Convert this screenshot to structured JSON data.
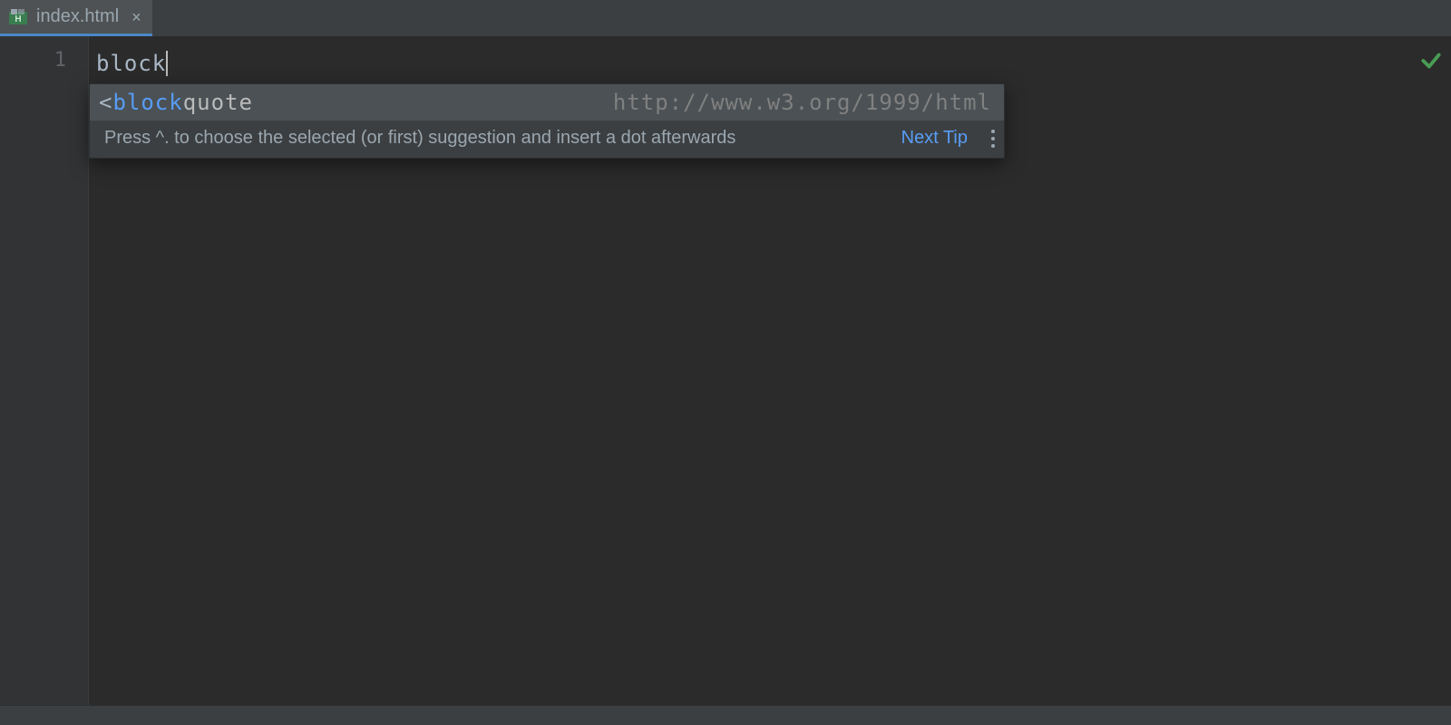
{
  "tab": {
    "label": "index.html",
    "icon": "html-file-icon"
  },
  "editor": {
    "line_numbers": [
      "1"
    ],
    "typed_text": "block"
  },
  "completion": {
    "items": [
      {
        "prefix": "<",
        "match": "block",
        "rest": "quote",
        "namespace": "http://www.w3.org/1999/html"
      }
    ],
    "hint_text": "Press ^. to choose the selected (or first) suggestion and insert a dot afterwards",
    "next_tip_label": "Next Tip"
  },
  "status": {
    "validation": "ok"
  }
}
